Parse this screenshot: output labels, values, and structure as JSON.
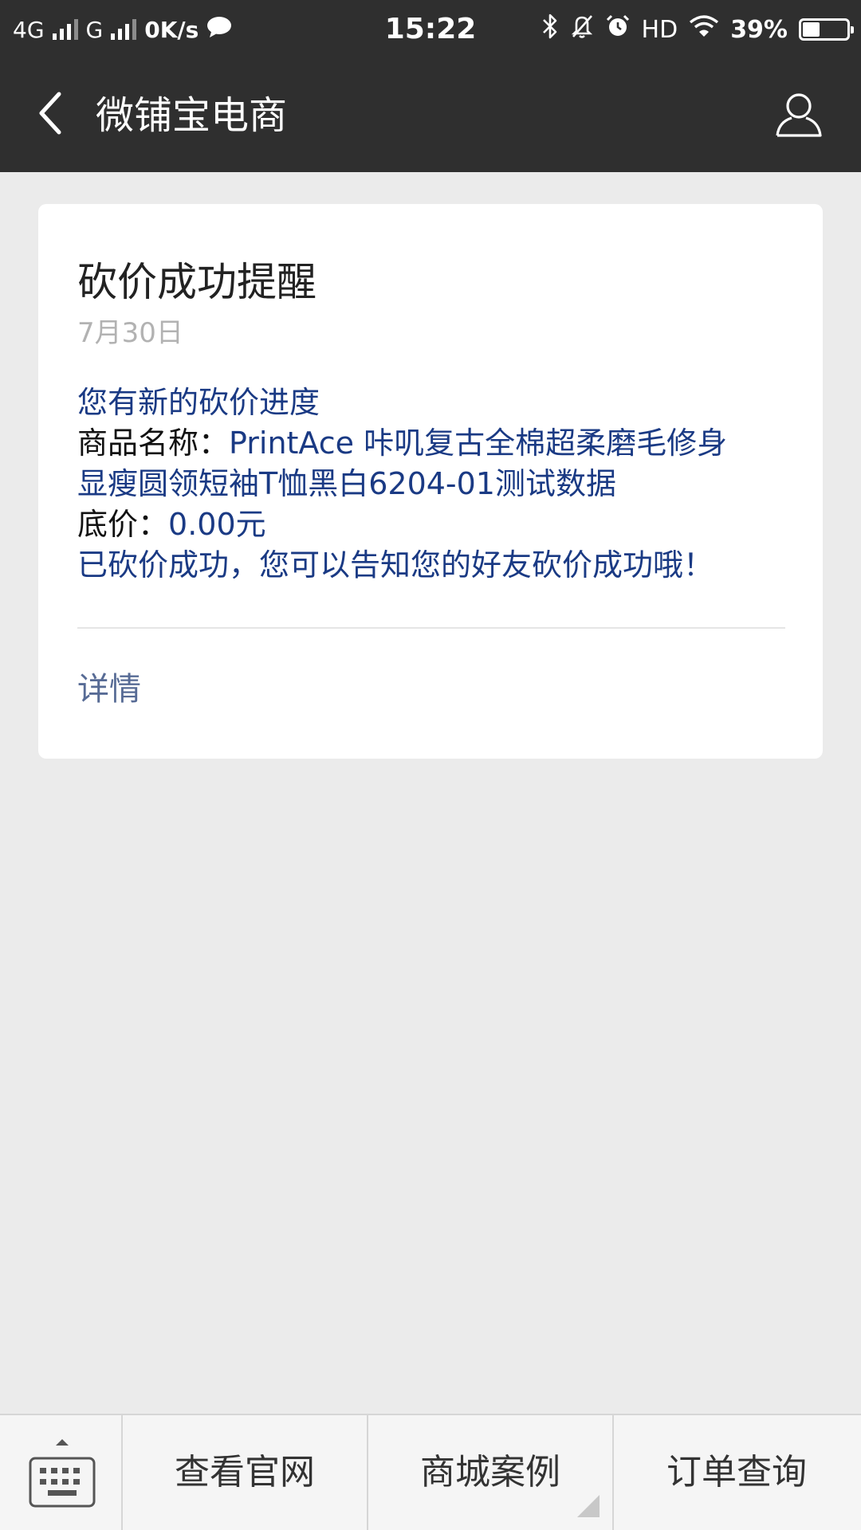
{
  "status_bar": {
    "network1": "4G",
    "network2": "G",
    "speed": "0K/s",
    "time": "15:22",
    "hd": "HD",
    "battery_percent_label": "39%",
    "battery_level": 0.39,
    "icons": [
      "signal-icon",
      "chat-bubble-icon",
      "bluetooth-icon",
      "bell-off-icon",
      "alarm-icon",
      "wifi-icon",
      "battery-icon"
    ]
  },
  "nav": {
    "title": "微铺宝电商",
    "back_icon": "chevron-left-icon",
    "profile_icon": "person-icon"
  },
  "message": {
    "title": "砍价成功提醒",
    "date": "7月30日",
    "first": "您有新的砍价进度",
    "product_label": "商品名称：",
    "product_line1": "PrintAce 咔叽复古全棉超柔磨毛修身",
    "product_line2": "显瘦圆领短袖T恤黑白6204-01测试数据",
    "price_label": "底价：",
    "price_value": "0.00元",
    "remark": "已砍价成功，您可以告知您的好友砍价成功哦！",
    "detail_link": "详情"
  },
  "bottom_menu": {
    "keyboard_icon": "keyboard-icon",
    "items": [
      {
        "label": "查看官网"
      },
      {
        "label": "商城案例"
      },
      {
        "label": "订单查询"
      }
    ]
  },
  "colors": {
    "bar_bg": "#2f2f2f",
    "page_bg": "#ebebeb",
    "blue_text": "#1a3a84",
    "link": "#576b95"
  }
}
